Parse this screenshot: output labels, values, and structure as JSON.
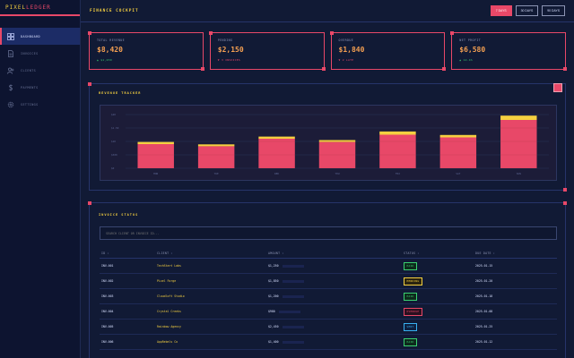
{
  "brand": {
    "part1": "PIXEL",
    "part2": "LEDGER"
  },
  "sidebar": {
    "items": [
      {
        "label": "DASHBOARD",
        "icon": "grid-icon",
        "active": true
      },
      {
        "label": "INVOICES",
        "icon": "document-icon",
        "active": false
      },
      {
        "label": "CLIENTS",
        "icon": "users-icon",
        "active": false
      },
      {
        "label": "PAYMENTS",
        "icon": "dollar-icon",
        "active": false
      },
      {
        "label": "SETTINGS",
        "icon": "gear-icon",
        "active": false
      }
    ]
  },
  "header": {
    "title": "FINANCE COCKPIT",
    "ranges": [
      {
        "label": "7 DAYS",
        "active": true
      },
      {
        "label": "30 DAYS",
        "active": false
      },
      {
        "label": "90 DAYS",
        "active": false
      }
    ]
  },
  "stats": [
    {
      "label": "TOTAL REVENUE",
      "value": "$8,420",
      "change": "▲ $1,250",
      "trend": "up"
    },
    {
      "label": "PENDING",
      "value": "$2,150",
      "change": "▼ 3 INVOICES",
      "trend": "down"
    },
    {
      "label": "OVERDUE",
      "value": "$1,840",
      "change": "▼ 2 LATE",
      "trend": "down"
    },
    {
      "label": "NET PROFIT",
      "value": "$6,580",
      "change": "▲ 12.4%",
      "trend": "up"
    }
  ],
  "revenue": {
    "title": "REVENUE TRACKER"
  },
  "chart_data": {
    "type": "bar",
    "categories": [
      "MON",
      "TUE",
      "WED",
      "THU",
      "FRI",
      "SAT",
      "SUN"
    ],
    "series": [
      {
        "values": [
          900,
          820,
          1100,
          980,
          1250,
          1150,
          1800
        ]
      },
      {
        "values": [
          80,
          70,
          80,
          70,
          120,
          90,
          160
        ]
      }
    ],
    "y_ticks": [
      "$2K",
      "$1.5K",
      "$1K",
      "$500",
      "$0"
    ],
    "ylim": [
      0,
      2000
    ],
    "stacked": true,
    "grid": true,
    "colors": {
      "primary": "#e84868",
      "secondary": "#f5d040"
    }
  },
  "invoices": {
    "title": "INVOICE STATUS",
    "search_placeholder": "SEARCH CLIENT OR INVOICE ID...",
    "columns": [
      "ID",
      "CLIENT",
      "AMOUNT",
      "STATUS",
      "DUE DATE"
    ],
    "rows": [
      {
        "id": "INV-001",
        "client": "TechStart Labs",
        "amount": "$1,250",
        "status": "PAID",
        "due": "2025-01-15"
      },
      {
        "id": "INV-002",
        "client": "Pixel Forge",
        "amount": "$1,850",
        "status": "PENDING",
        "due": "2025-01-20"
      },
      {
        "id": "INV-003",
        "client": "Cloudloft Studio",
        "amount": "$1,200",
        "status": "PAID",
        "due": "2025-01-18"
      },
      {
        "id": "INV-004",
        "client": "Crystal Creeks",
        "amount": "$980",
        "status": "OVERDUE",
        "due": "2025-01-08"
      },
      {
        "id": "INV-005",
        "client": "Rainbow Agency",
        "amount": "$2,450",
        "status": "SENT",
        "due": "2025-01-25"
      },
      {
        "id": "INV-006",
        "client": "AppRebels Co",
        "amount": "$1,400",
        "status": "PAID",
        "due": "2025-01-12"
      }
    ]
  }
}
